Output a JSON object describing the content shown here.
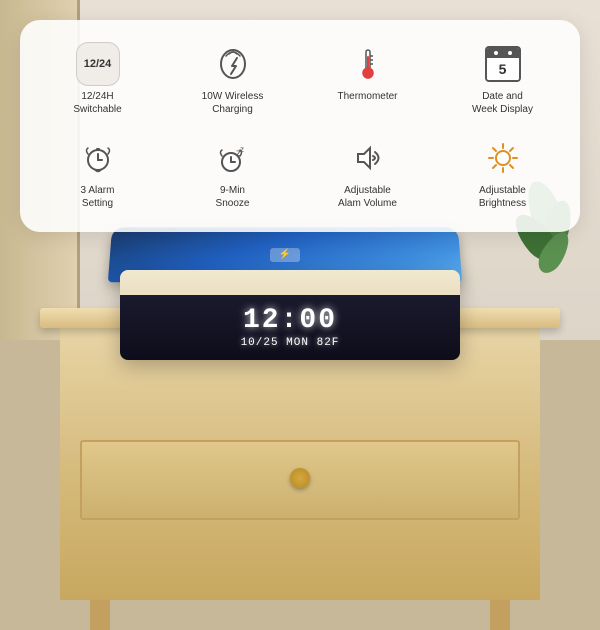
{
  "features": {
    "row1": [
      {
        "id": "time-format",
        "icon_type": "time-badge",
        "icon_text": "12/24",
        "label": "12/24H\nSwitchable"
      },
      {
        "id": "wireless-charging",
        "icon_type": "wireless",
        "label": "10W Wireless\nCharging"
      },
      {
        "id": "thermometer",
        "icon_type": "thermometer",
        "label": "Thermometer"
      },
      {
        "id": "date-display",
        "icon_type": "calendar",
        "icon_num": "5",
        "label": "Date and\nWeek Display"
      }
    ],
    "row2": [
      {
        "id": "alarm",
        "icon_type": "alarm",
        "label": "3 Alarm\nSetting"
      },
      {
        "id": "snooze",
        "icon_type": "snooze",
        "label": "9-Min\nSnooze"
      },
      {
        "id": "volume",
        "icon_type": "volume",
        "label": "Adjustable\nAlam Volume"
      },
      {
        "id": "brightness",
        "icon_type": "brightness",
        "label": "Adjustable\nBrightness"
      }
    ]
  },
  "clock": {
    "time": "12:00",
    "date": "10/25 MON  82F"
  },
  "divider_label": "···"
}
